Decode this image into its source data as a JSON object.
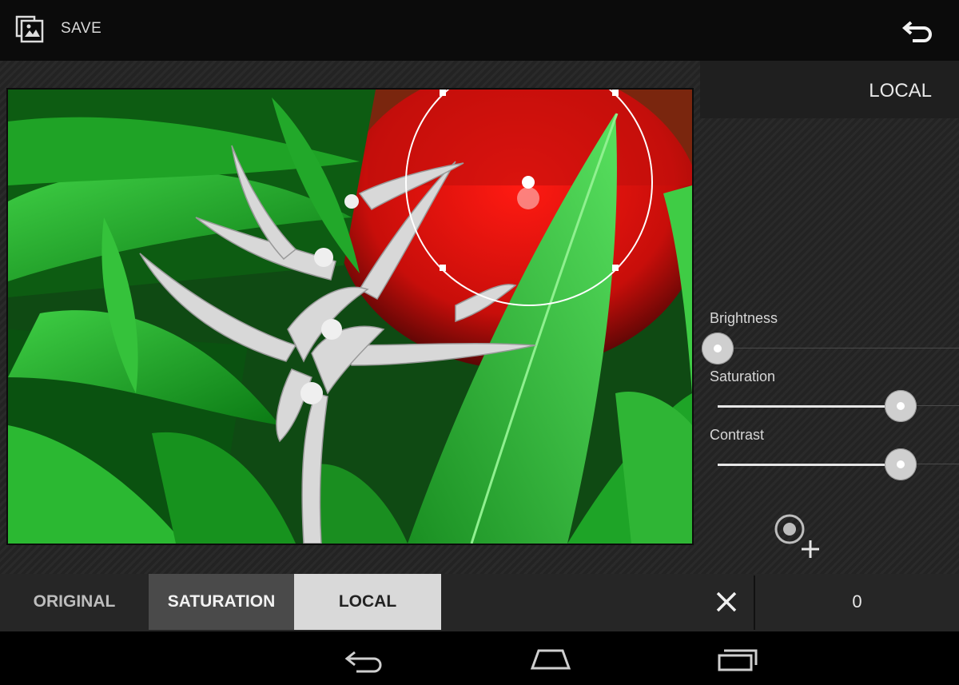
{
  "topbar": {
    "save_label": "SAVE",
    "save_icon": "photo-save-icon",
    "undo_icon": "undo-icon"
  },
  "panel": {
    "title": "LOCAL",
    "sliders": [
      {
        "label": "Brightness",
        "value_fraction": 0.0
      },
      {
        "label": "Saturation",
        "value_fraction": 0.76
      },
      {
        "label": "Contrast",
        "value_fraction": 0.76
      }
    ],
    "add_point_icon": "add-control-point-icon"
  },
  "filterbar": {
    "tabs": [
      {
        "label": "ORIGINAL",
        "state": "inactive"
      },
      {
        "label": "SATURATION",
        "state": "applied"
      },
      {
        "label": "LOCAL",
        "state": "selected"
      }
    ],
    "close_icon": "close-icon",
    "value": "0"
  },
  "navbar": {
    "icons": [
      "back-icon",
      "home-icon",
      "recents-icon"
    ]
  },
  "colors": {
    "background": "#111111",
    "panel": "#1f1f1f",
    "selected_tab": "#d9d9d9",
    "accent_white": "#ffffff"
  }
}
